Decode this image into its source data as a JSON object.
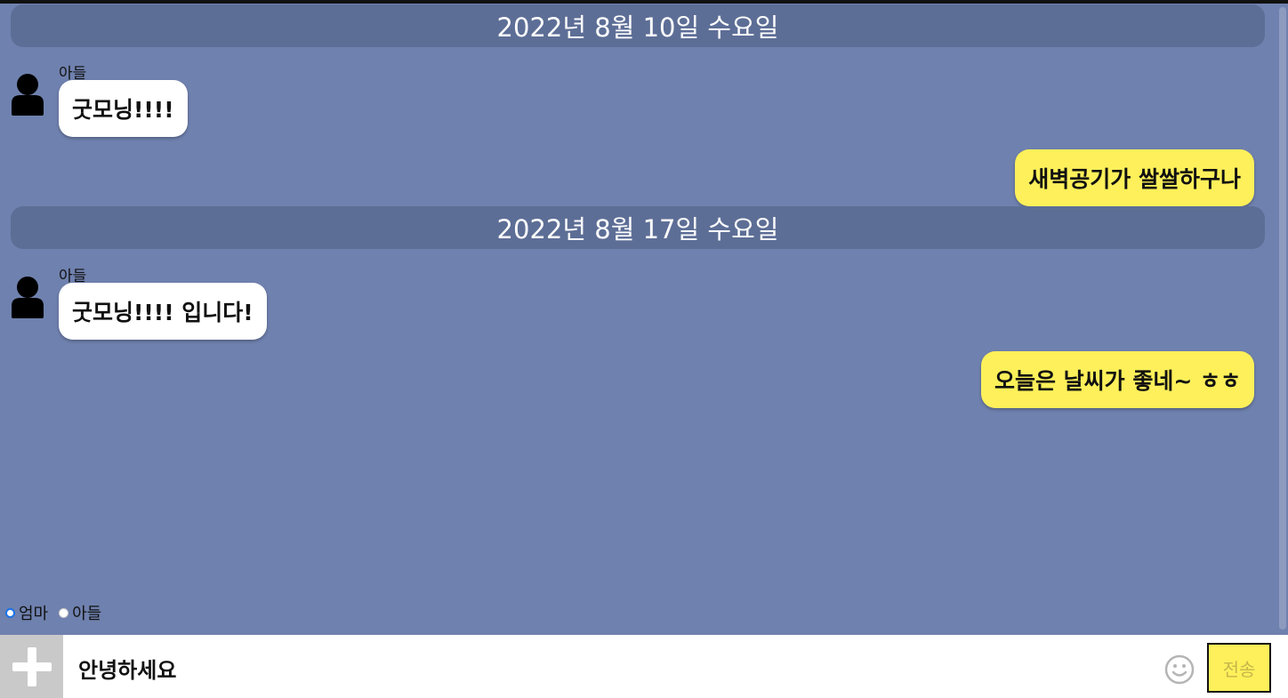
{
  "messages_by_day": [
    {
      "date_label": "2022년 8월 10일 수요일",
      "incoming": {
        "sender": "아들",
        "text": "굿모닝!!!!"
      },
      "outgoing": {
        "text": "새벽공기가 쌀쌀하구나"
      }
    },
    {
      "date_label": "2022년 8월 17일 수요일",
      "incoming": {
        "sender": "아들",
        "text": "굿모닝!!!! 입니다!"
      },
      "outgoing": {
        "text": "오늘은 날씨가 좋네~ ㅎㅎ"
      }
    }
  ],
  "role_selector": {
    "options": [
      "엄마",
      "아들"
    ],
    "selected": "엄마"
  },
  "composer": {
    "input_value": "안녕하세요",
    "send_label": "전송",
    "plus_icon": "plus-icon",
    "emoji_icon": "smiley-icon"
  },
  "colors": {
    "background": "#6f81ae",
    "date_banner": "#5d6e96",
    "incoming_bubble": "#ffffff",
    "outgoing_bubble": "#fdf05a",
    "send_button": "#fdf05a"
  }
}
